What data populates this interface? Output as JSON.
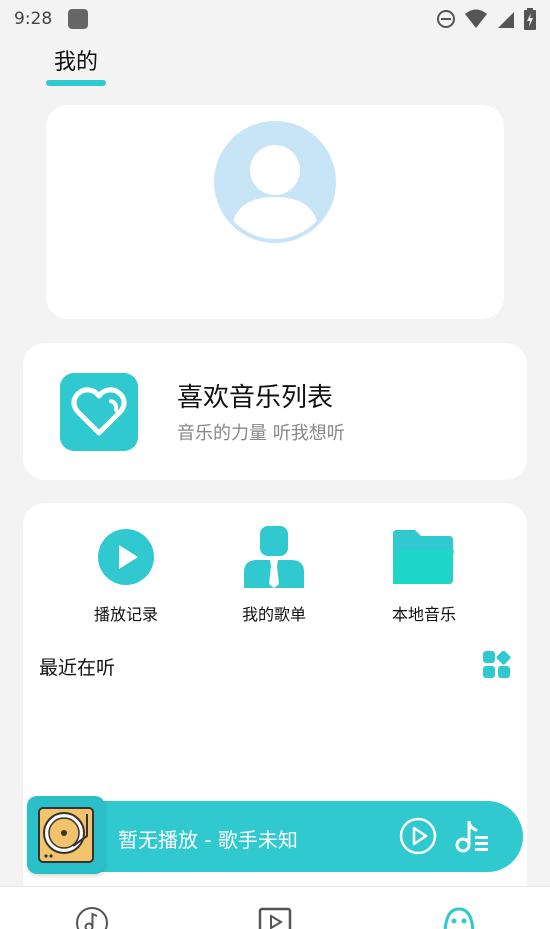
{
  "status_bar": {
    "time": "9:28"
  },
  "page": {
    "title": "我的"
  },
  "favorites": {
    "title": "喜欢音乐列表",
    "subtitle": "音乐的力量 听我想听"
  },
  "quick_actions": [
    {
      "label": "播放记录",
      "icon": "play-circle-icon"
    },
    {
      "label": "我的歌单",
      "icon": "user-tie-icon"
    },
    {
      "label": "本地音乐",
      "icon": "folder-icon"
    }
  ],
  "recent": {
    "title": "最近在听",
    "icon": "grid-icon"
  },
  "player": {
    "text": "暂无播放 - 歌手未知"
  },
  "bottom_nav": [
    "music-note-icon",
    "video-play-icon",
    "mine-face-icon"
  ],
  "colors": {
    "accent": "#2fc9cf",
    "avatar": "#c8e5f7",
    "background": "#f3f3f3"
  }
}
